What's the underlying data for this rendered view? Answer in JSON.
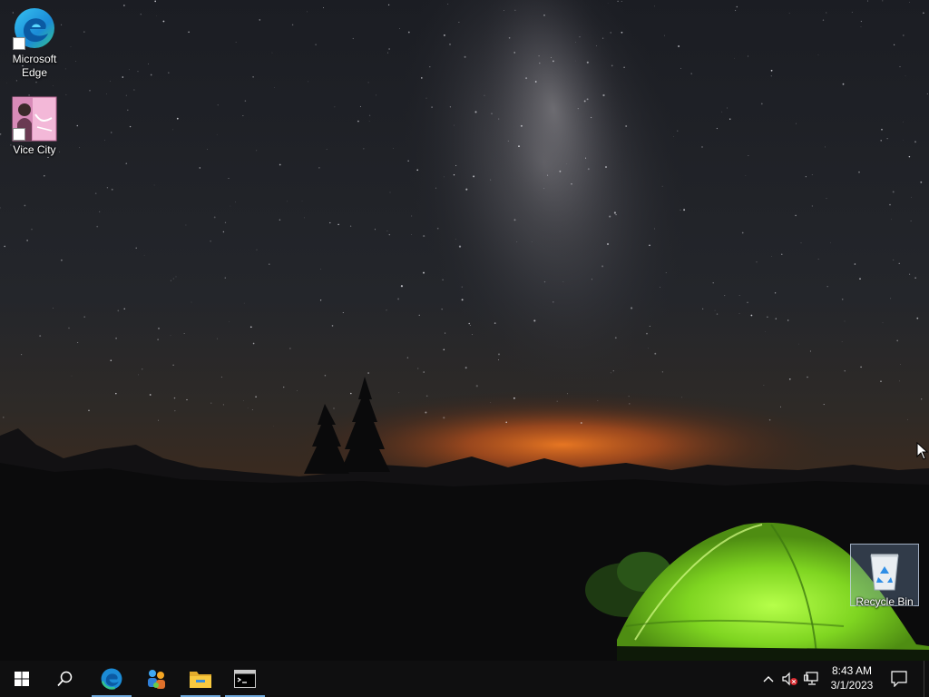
{
  "desktop": {
    "icons": [
      {
        "label": "Microsoft Edge",
        "icon": "edge-icon"
      },
      {
        "label": "Vice City",
        "icon": "vice-city-icon"
      },
      {
        "label": "Recycle Bin",
        "icon": "recycle-bin-icon"
      }
    ],
    "wallpaper": "night-sky-camping-tent"
  },
  "taskbar": {
    "start_icon": "windows-logo-icon",
    "search_icon": "search-icon",
    "pinned": [
      {
        "icon": "edge-icon",
        "running": true
      },
      {
        "icon": "people-network-icon",
        "running": false
      },
      {
        "icon": "file-explorer-icon",
        "running": true
      },
      {
        "icon": "command-prompt-icon",
        "running": true
      }
    ],
    "tray": {
      "icons": [
        "chevron-up-icon",
        "volume-muted-icon",
        "network-icon"
      ],
      "time": "8:43 AM",
      "date": "3/1/2023",
      "notification_icon": "notification-icon"
    }
  },
  "colors": {
    "taskbar": "#0f0f10",
    "running_indicator": "#6fa8dc",
    "tent": "#8ee32a",
    "horizon_glow": "#d8621c"
  }
}
